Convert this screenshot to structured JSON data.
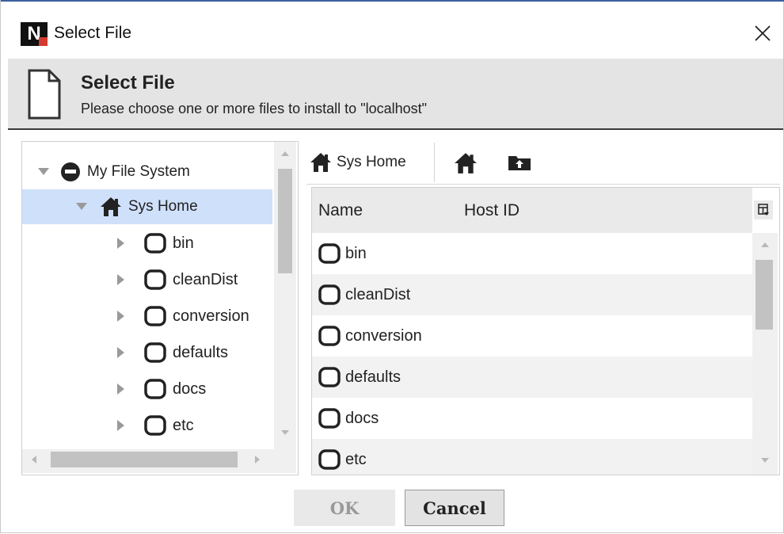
{
  "window": {
    "title": "Select File",
    "close_icon": "close-icon",
    "app_icon": "niagara-logo-icon",
    "logo_letter": "N"
  },
  "header": {
    "title": "Select File",
    "subtitle": "Please choose one or more files to install to \"localhost\"",
    "icon": "document-icon"
  },
  "tree": {
    "items": [
      {
        "label": "My File System",
        "icon": "drive-icon",
        "expanded": true,
        "selected": false
      },
      {
        "label": "Sys Home",
        "icon": "home-icon",
        "expanded": true,
        "selected": true
      },
      {
        "label": "bin",
        "icon": "folder-icon",
        "expanded": false,
        "selected": false
      },
      {
        "label": "cleanDist",
        "icon": "folder-icon",
        "expanded": false,
        "selected": false
      },
      {
        "label": "conversion",
        "icon": "folder-icon",
        "expanded": false,
        "selected": false
      },
      {
        "label": "defaults",
        "icon": "folder-icon",
        "expanded": false,
        "selected": false
      },
      {
        "label": "docs",
        "icon": "folder-icon",
        "expanded": false,
        "selected": false
      },
      {
        "label": "etc",
        "icon": "folder-icon",
        "expanded": false,
        "selected": false
      }
    ]
  },
  "navbar": {
    "location_label": "Sys Home",
    "location_icon": "home-icon",
    "home_icon": "home-icon",
    "up_icon": "folder-up-icon"
  },
  "list": {
    "columns": [
      "Name",
      "Host ID"
    ],
    "column_chooser_icon": "column-chooser-icon",
    "rows": [
      {
        "name": "bin",
        "icon": "folder-icon"
      },
      {
        "name": "cleanDist",
        "icon": "folder-icon"
      },
      {
        "name": "conversion",
        "icon": "folder-icon"
      },
      {
        "name": "defaults",
        "icon": "folder-icon"
      },
      {
        "name": "docs",
        "icon": "folder-icon"
      },
      {
        "name": "etc",
        "icon": "folder-icon"
      }
    ]
  },
  "buttons": {
    "ok": "OK",
    "cancel": "Cancel",
    "ok_enabled": false
  },
  "colors": {
    "selection": "#cfe0fb",
    "accent": "#3c5fa0",
    "header_bg": "#e4e4e4"
  }
}
